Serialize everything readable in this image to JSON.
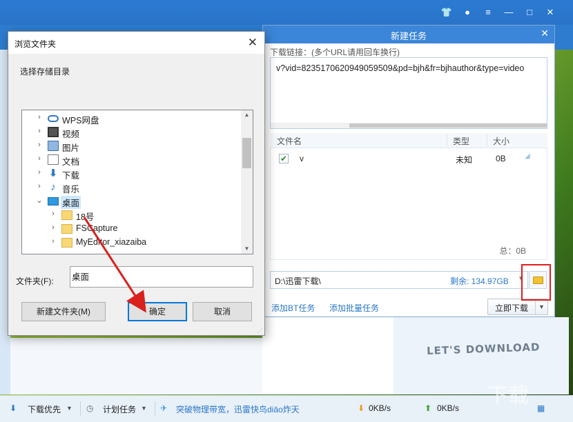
{
  "main_window": {
    "statusbar": {
      "download_priority": "下载优先",
      "scheduled_tasks": "计划任务",
      "promo_text": "突破物理带宽，迅雷快鸟diāo炸天",
      "download_speed": "0KB/s",
      "upload_speed": "0KB/s"
    },
    "lets_download": "LET'S DOWNLOAD"
  },
  "new_task_dialog": {
    "title": "新建任务",
    "close_label": "✕",
    "url_label": "下载链接：(多个URL请用回车换行)",
    "url_value": "v?vid=8235170620949059509&pd=bjh&fr=bjhauthor&type=video",
    "columns": {
      "name": "文件名",
      "type": "类型",
      "size": "大小"
    },
    "files": [
      {
        "checked": true,
        "name": "v",
        "type": "未知",
        "size": "0B"
      }
    ],
    "total": "总：0B",
    "save_path": "D:\\迅雷下载\\",
    "free_space": "剩余: 134.97GB",
    "add_bt_task": "添加BT任务",
    "add_batch_task": "添加批量任务",
    "start_download": "立即下载"
  },
  "browse_dialog": {
    "title": "浏览文件夹",
    "close_label": "✕",
    "instruction": "选择存储目录",
    "tree": [
      {
        "label": "WPS网盘",
        "icon": "cloud-icon",
        "expanded": false
      },
      {
        "label": "视频",
        "icon": "video-folder-icon",
        "expanded": false
      },
      {
        "label": "图片",
        "icon": "image-folder-icon",
        "expanded": false
      },
      {
        "label": "文档",
        "icon": "document-folder-icon",
        "expanded": false
      },
      {
        "label": "下载",
        "icon": "download-folder-icon",
        "expanded": false
      },
      {
        "label": "音乐",
        "icon": "music-folder-icon",
        "expanded": false
      },
      {
        "label": "桌面",
        "icon": "desktop-icon",
        "expanded": true,
        "selected": true
      },
      {
        "label": "18号",
        "icon": "folder-icon",
        "expanded": false
      },
      {
        "label": "FSCapture",
        "icon": "folder-icon",
        "expanded": false
      },
      {
        "label": "MyEditor_xiazaiba",
        "icon": "folder-icon",
        "expanded": false
      }
    ],
    "folder_label": "文件夹(F):",
    "folder_value": "桌面",
    "new_folder_button": "新建文件夹(M)",
    "ok_button": "确定",
    "cancel_button": "取消"
  },
  "colors": {
    "thunder_blue": "#2b7ad2",
    "link_blue": "#2a78c8",
    "highlight_red": "#e01c1c",
    "selection_blue": "#cce8ff"
  }
}
